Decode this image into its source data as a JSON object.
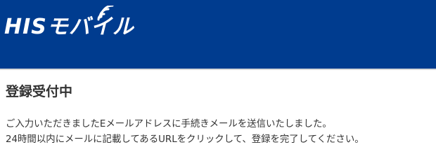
{
  "header": {
    "logo_text": "HISモバイル",
    "background_color": "#003c8f"
  },
  "main": {
    "title": "登録受付中",
    "message_lines": [
      "ご入力いただきましたEメールアドレスに手続きメールを送信いたしました。",
      "24時間以内にメールに記載してあるURLをクリックして、登録を完了してください。"
    ]
  }
}
